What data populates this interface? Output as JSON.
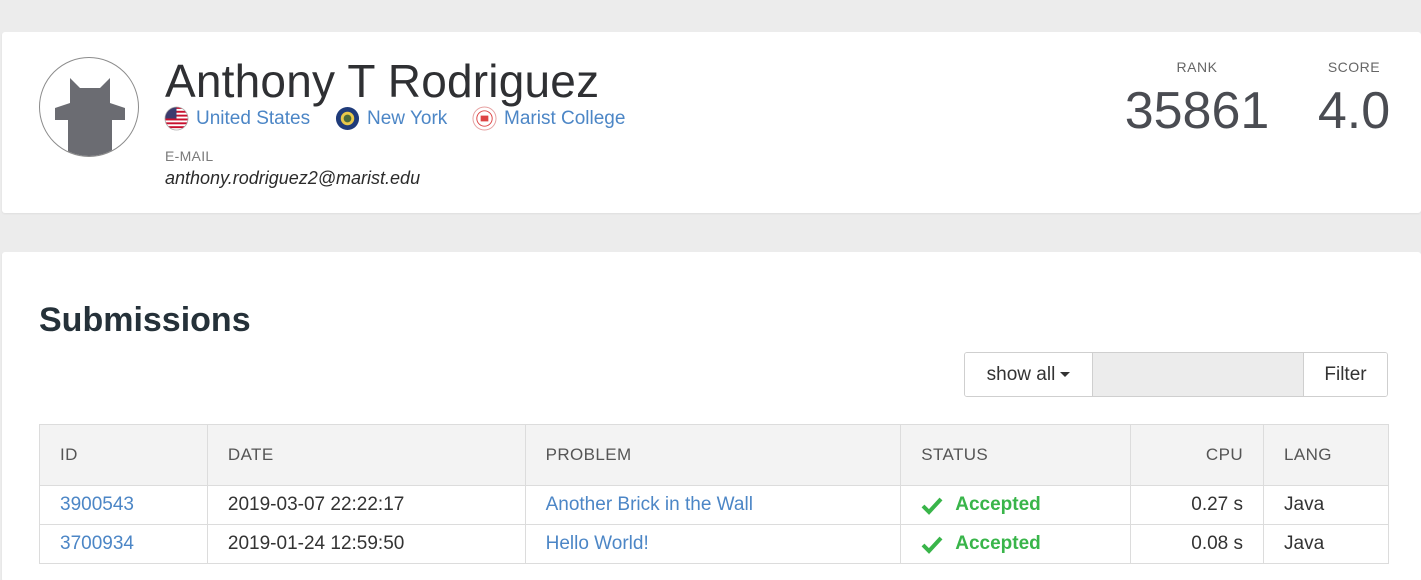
{
  "profile": {
    "name": "Anthony T Rodriguez",
    "affiliations": [
      {
        "label": "United States",
        "icon": "us-flag-icon"
      },
      {
        "label": "New York",
        "icon": "new-york-seal-icon"
      },
      {
        "label": "Marist College",
        "icon": "marist-college-logo-icon"
      }
    ],
    "email_label": "E-MAIL",
    "email": "anthony.rodriguez2@marist.edu",
    "rank_label": "RANK",
    "rank": "35861",
    "score_label": "SCORE",
    "score": "4.0"
  },
  "submissions": {
    "title": "Submissions",
    "filter": {
      "dropdown_label": "show all",
      "input_value": "",
      "button_label": "Filter"
    },
    "columns": [
      "ID",
      "DATE",
      "PROBLEM",
      "STATUS",
      "CPU",
      "LANG"
    ],
    "rows": [
      {
        "id": "3900543",
        "date": "2019-03-07 22:22:17",
        "problem": "Another Brick in the Wall",
        "status": "Accepted",
        "cpu": "0.27 s",
        "lang": "Java"
      },
      {
        "id": "3700934",
        "date": "2019-01-24 12:59:50",
        "problem": "Hello World!",
        "status": "Accepted",
        "cpu": "0.08 s",
        "lang": "Java"
      }
    ]
  },
  "colors": {
    "link": "#4c86c6",
    "accepted": "#39b54a",
    "background": "#ececec"
  }
}
